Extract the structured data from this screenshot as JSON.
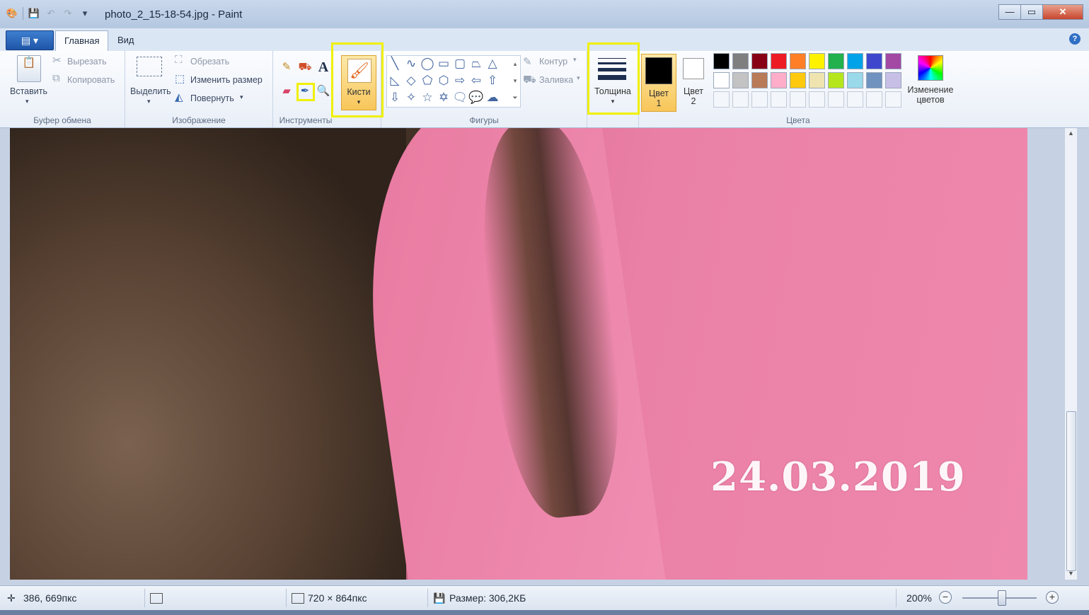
{
  "window": {
    "title": "photo_2_15-18-54.jpg - Paint",
    "minimize": "—",
    "maximize": "▭",
    "close": "✕"
  },
  "tabs": {
    "menu": "▤ ▾",
    "home": "Главная",
    "view": "Вид",
    "help": "?"
  },
  "clipboard": {
    "paste": "Вставить",
    "cut": "Вырезать",
    "copy": "Копировать",
    "label": "Буфер обмена"
  },
  "image": {
    "select": "Выделить",
    "crop": "Обрезать",
    "resize": "Изменить размер",
    "rotate": "Повернуть",
    "label": "Изображение"
  },
  "tools": {
    "label": "Инструменты",
    "text_tool": "A"
  },
  "brushes": {
    "label": "Кисти"
  },
  "shapes": {
    "outline": "Контур",
    "fill": "Заливка",
    "label": "Фигуры"
  },
  "size": {
    "label": "Толщина"
  },
  "colors": {
    "color1_line1": "Цвет",
    "color1_line2": "1",
    "color2_line1": "Цвет",
    "color2_line2": "2",
    "edit_line1": "Изменение",
    "edit_line2": "цветов",
    "label": "Цвета",
    "color1": "#000000",
    "color2": "#ffffff",
    "palette_row1": [
      "#000000",
      "#7f7f7f",
      "#880015",
      "#ed1c24",
      "#ff7f27",
      "#fff200",
      "#22b14c",
      "#00a2e8",
      "#3f48cc",
      "#a349a4"
    ],
    "palette_row2": [
      "#ffffff",
      "#c3c3c3",
      "#b97a57",
      "#ffaec9",
      "#ffc90e",
      "#efe4b0",
      "#b5e61d",
      "#99d9ea",
      "#7092be",
      "#c8bfe7"
    ],
    "highlight": "#f0f000"
  },
  "canvas": {
    "date_stamp": "24.03.2019"
  },
  "status": {
    "cursor_pos": "386, 669пкс",
    "image_size": "720 × 864пкс",
    "file_size": "Размер: 306,2КБ",
    "zoom": "200%"
  }
}
